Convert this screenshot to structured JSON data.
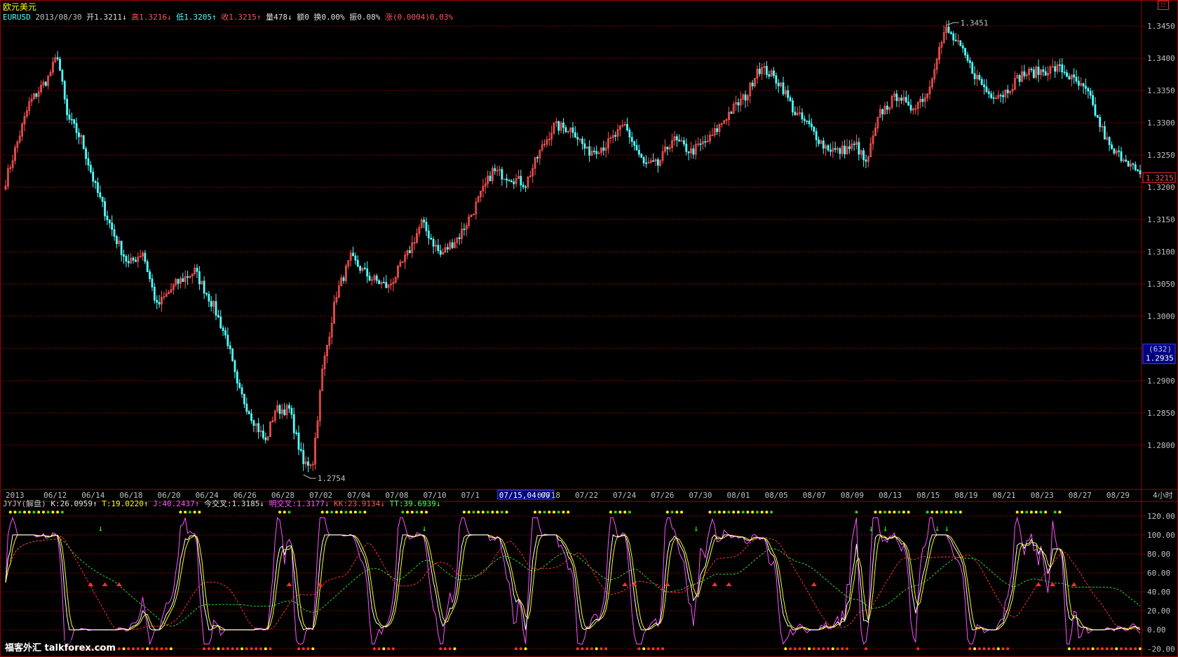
{
  "header": {
    "title": "欧元美元",
    "symbol": "EURUSD",
    "date": "2013/08/30",
    "open": "开1.3211↓",
    "high": "高1.3216↓",
    "low": "低1.3205↑",
    "close": "收1.3215↑",
    "volume": "量478↓",
    "amount": "额0",
    "turnover": "换0.00%",
    "amplitude": "振0.08%",
    "change": "涨(0.0004)0.03%"
  },
  "indicator_header": {
    "name": "JYJY(解盘)",
    "k": "K:26.0959↑",
    "t": "T:19.0220↑",
    "j": "J:40.2437↑",
    "today_cross": "今交叉:1.3185↓",
    "tomorrow_cross": "明交叉:1.3177↓",
    "kk": "KK:23.9134↓",
    "tt": "TT:39.6939↓"
  },
  "window_button": "□",
  "watermark": "福客外汇 talkforex.com",
  "colors": {
    "background": "#000000",
    "up_candle": "#ff5454",
    "down_candle": "#54ffff",
    "grid": "#8b0000",
    "axis_text": "#c0c0c0",
    "k_line": "#ffffff",
    "t_line": "#ffff00",
    "j_line": "#ff54ff",
    "kk_line": "#ff3030",
    "tt_line": "#30d030"
  },
  "chart_data": [
    {
      "type": "candlestick",
      "symbol": "EURUSD",
      "timeframe": "4小时",
      "ylim": [
        1.274,
        1.346
      ],
      "y_ticks": [
        "1.3450",
        "1.3400",
        "1.3350",
        "1.3300",
        "1.3250",
        "1.3200",
        "1.3150",
        "1.3100",
        "1.3050",
        "1.3000",
        "1.2950",
        "1.2900",
        "1.2850",
        "1.2800"
      ],
      "date_labels": [
        "2013",
        "06/12",
        "06/14",
        "06/18",
        "06/20",
        "06/24",
        "06/26",
        "06/28",
        "07/02",
        "07/04",
        "07/08",
        "07/10",
        "07/1",
        "07/15,04:00",
        "07/18",
        "07/22",
        "07/24",
        "07/26",
        "07/30",
        "08/01",
        "08/05",
        "08/07",
        "08/09",
        "08/13",
        "08/15",
        "08/19",
        "08/21",
        "08/23",
        "08/27",
        "08/29"
      ],
      "date_label_positions": [
        0,
        1,
        2,
        3,
        4,
        5,
        6,
        7,
        8,
        9,
        10,
        11,
        12,
        13,
        14,
        15,
        16,
        17,
        18,
        19,
        20,
        21,
        22,
        23,
        24,
        25,
        26,
        27,
        28,
        29
      ],
      "high_marker": "1.3451",
      "low_marker": "1.2754",
      "last_price": "1.3215",
      "cursor_count": "(632)",
      "cursor_price": "1.2935",
      "cursor_price_value": 1.2935,
      "timeframe_label": "4小时",
      "anchors": [
        [
          0,
          1.321
        ],
        [
          10,
          1.333
        ],
        [
          18,
          1.337
        ],
        [
          22,
          1.3405
        ],
        [
          26,
          1.331
        ],
        [
          32,
          1.3275
        ],
        [
          38,
          1.32
        ],
        [
          46,
          1.3125
        ],
        [
          52,
          1.308
        ],
        [
          58,
          1.31
        ],
        [
          64,
          1.3015
        ],
        [
          72,
          1.305
        ],
        [
          80,
          1.307
        ],
        [
          88,
          1.3015
        ],
        [
          94,
          1.296
        ],
        [
          98,
          1.289
        ],
        [
          104,
          1.2845
        ],
        [
          110,
          1.2805
        ],
        [
          114,
          1.2855
        ],
        [
          120,
          1.2855
        ],
        [
          126,
          1.277
        ],
        [
          130,
          1.2775
        ],
        [
          134,
          1.2915
        ],
        [
          140,
          1.3035
        ],
        [
          146,
          1.309
        ],
        [
          154,
          1.306
        ],
        [
          162,
          1.3045
        ],
        [
          170,
          1.3095
        ],
        [
          176,
          1.3145
        ],
        [
          184,
          1.3095
        ],
        [
          192,
          1.3125
        ],
        [
          198,
          1.3165
        ],
        [
          206,
          1.3225
        ],
        [
          214,
          1.3215
        ],
        [
          220,
          1.3205
        ],
        [
          226,
          1.3255
        ],
        [
          232,
          1.3295
        ],
        [
          240,
          1.329
        ],
        [
          246,
          1.3255
        ],
        [
          254,
          1.3265
        ],
        [
          262,
          1.3295
        ],
        [
          270,
          1.3235
        ],
        [
          276,
          1.3235
        ],
        [
          282,
          1.3275
        ],
        [
          290,
          1.3255
        ],
        [
          298,
          1.3275
        ],
        [
          306,
          1.3315
        ],
        [
          314,
          1.3345
        ],
        [
          318,
          1.3385
        ],
        [
          322,
          1.338
        ],
        [
          328,
          1.336
        ],
        [
          334,
          1.3315
        ],
        [
          340,
          1.3295
        ],
        [
          346,
          1.3265
        ],
        [
          352,
          1.3255
        ],
        [
          360,
          1.3265
        ],
        [
          364,
          1.3235
        ],
        [
          370,
          1.3315
        ],
        [
          378,
          1.3345
        ],
        [
          382,
          1.332
        ],
        [
          390,
          1.3345
        ],
        [
          394,
          1.3405
        ],
        [
          398,
          1.3445
        ],
        [
          404,
          1.3415
        ],
        [
          410,
          1.3375
        ],
        [
          416,
          1.3345
        ],
        [
          422,
          1.3345
        ],
        [
          430,
          1.3375
        ],
        [
          438,
          1.338
        ],
        [
          446,
          1.3385
        ],
        [
          452,
          1.3365
        ],
        [
          458,
          1.3345
        ],
        [
          462,
          1.3305
        ],
        [
          468,
          1.3255
        ],
        [
          474,
          1.3245
        ],
        [
          480,
          1.3215
        ]
      ]
    },
    {
      "type": "line",
      "indicator": "JYJY(解盘)",
      "ylim": [
        -22,
        128
      ],
      "y_ticks": [
        "120.00",
        "100.00",
        "80.00",
        "60.00",
        "40.00",
        "20.00",
        "0.00",
        "-20.00"
      ],
      "series": [
        {
          "name": "K",
          "last": 26.0959
        },
        {
          "name": "T",
          "last": 19.022
        },
        {
          "name": "J",
          "last": 40.2437
        },
        {
          "name": "KK",
          "last": 23.9134
        },
        {
          "name": "TT",
          "last": 39.6939
        }
      ],
      "buy_arrow_positions": [
        40,
        177,
        292,
        366,
        372,
        394,
        398
      ],
      "sell_arrow_positions": [
        36,
        42,
        48,
        120,
        133,
        262,
        266,
        280,
        300,
        306,
        342,
        437,
        443,
        452
      ]
    }
  ]
}
